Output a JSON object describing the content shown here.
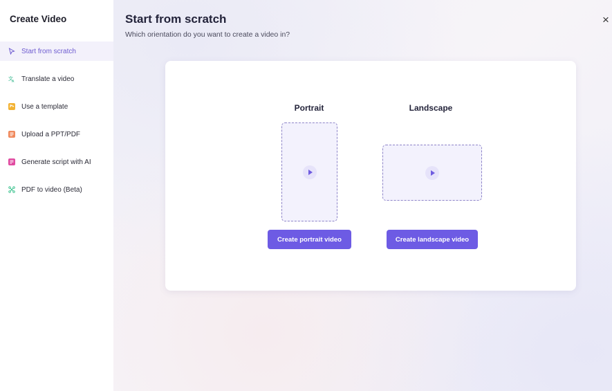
{
  "sidebar": {
    "title": "Create Video",
    "items": [
      {
        "label": "Start from scratch",
        "icon": "cursor-icon",
        "color": "#6d5bd0",
        "active": true
      },
      {
        "label": "Translate a video",
        "icon": "translate-icon",
        "color": "#2fb58a"
      },
      {
        "label": "Use a template",
        "icon": "template-icon",
        "color": "#f2b233"
      },
      {
        "label": "Upload a PPT/PDF",
        "icon": "document-icon",
        "color": "#f08a5d"
      },
      {
        "label": "Generate script with AI",
        "icon": "script-icon",
        "color": "#e04aa0"
      },
      {
        "label": "PDF to video (Beta)",
        "icon": "network-icon",
        "color": "#35c08a"
      }
    ]
  },
  "main": {
    "title": "Start from scratch",
    "subtitle": "Which orientation do you want to create a video in?",
    "close_glyph": "×",
    "options": {
      "portrait": {
        "label": "Portrait",
        "button": "Create portrait video"
      },
      "landscape": {
        "label": "Landscape",
        "button": "Create landscape video"
      }
    }
  },
  "colors": {
    "accent": "#6d5be4",
    "frame_border": "#8d84c8",
    "frame_fill": "#f3f2fd"
  }
}
